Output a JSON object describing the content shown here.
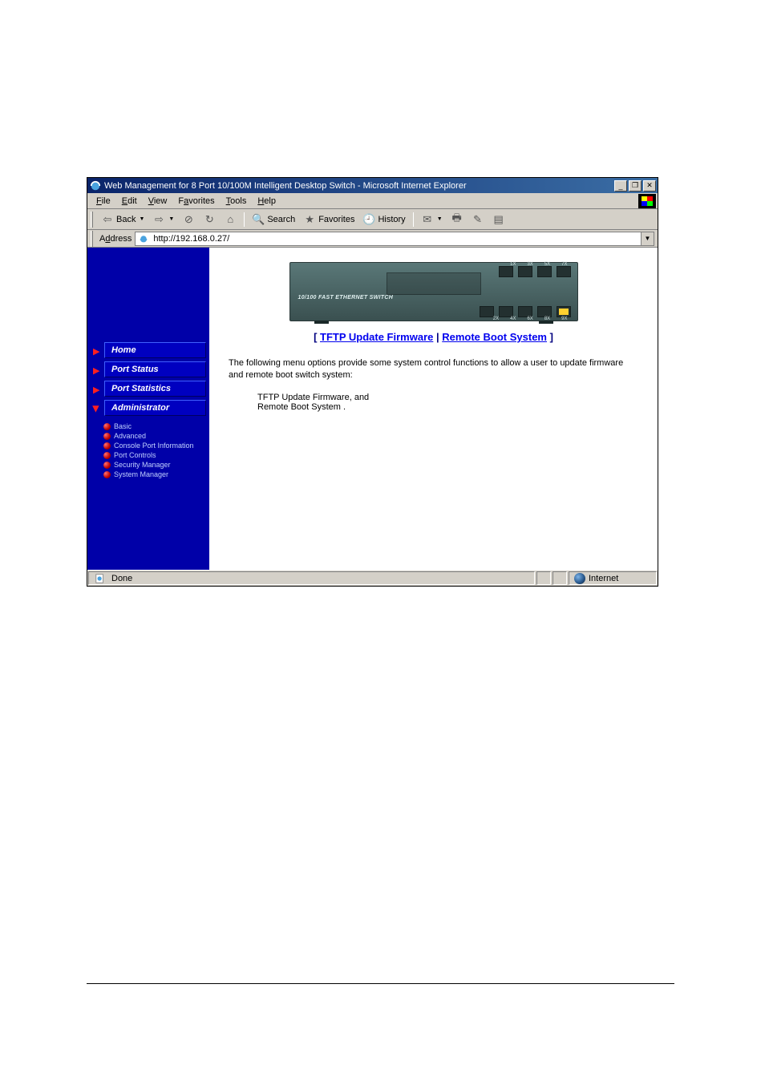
{
  "window": {
    "title": "Web Management for 8 Port 10/100M Intelligent Desktop Switch - Microsoft Internet Explorer"
  },
  "menubar": {
    "file": "File",
    "edit": "Edit",
    "view": "View",
    "favorites": "Favorites",
    "tools": "Tools",
    "help": "Help"
  },
  "toolbar": {
    "back": "Back",
    "search": "Search",
    "favorites": "Favorites",
    "history": "History"
  },
  "addressbar": {
    "label": "Address",
    "url": "http://192.168.0.27/"
  },
  "sidebar": {
    "items": [
      {
        "label": "Home"
      },
      {
        "label": "Port Status"
      },
      {
        "label": "Port Statistics"
      },
      {
        "label": "Administrator"
      }
    ],
    "sub": [
      "Basic",
      "Advanced",
      "Console Port Information",
      "Port Controls",
      "Security Manager",
      "System Manager"
    ]
  },
  "main": {
    "switch_label": "10/100 FAST ETHERNET SWITCH",
    "port_labels_top": [
      "1X",
      "3X",
      "5X",
      "7X"
    ],
    "port_labels_bot": [
      "2X",
      "4X",
      "6X",
      "8X",
      "9X"
    ],
    "bracket_open": "[ ",
    "link1": "TFTP Update Firmware",
    "sep": " | ",
    "link2": "Remote Boot System",
    "bracket_close": " ]",
    "para": "The following menu options provide some system control functions to allow a user to update firmware and remote boot switch system:",
    "list1": "TFTP Update Firmware, and",
    "list2": "Remote Boot System ."
  },
  "statusbar": {
    "done": "Done",
    "zone": "Internet"
  }
}
